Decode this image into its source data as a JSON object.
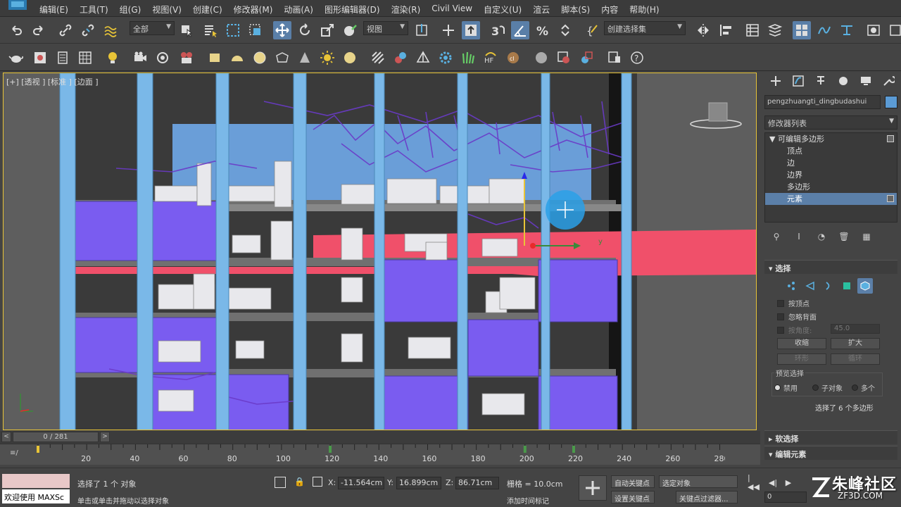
{
  "menu": [
    "编辑(E)",
    "工具(T)",
    "组(G)",
    "视图(V)",
    "创建(C)",
    "修改器(M)",
    "动画(A)",
    "图形编辑器(D)",
    "渲染(R)",
    "Civil View",
    "自定义(U)",
    "渲云",
    "脚本(S)",
    "内容",
    "帮助(H)"
  ],
  "toolbar": {
    "selection_filter": "全部",
    "ref_coord": "视图",
    "named_selection": "创建选择集"
  },
  "viewport": {
    "label": "[+] [透视 ] [标准 ] [边面 ]",
    "axis_label": "y"
  },
  "command_panel": {
    "object_name": "pengzhuangti_dingbudashui",
    "object_color": "#5b9bd5",
    "modifier_list": "修改器列表",
    "stack": [
      {
        "label": "可编辑多边形",
        "root": true
      },
      {
        "label": "顶点"
      },
      {
        "label": "边"
      },
      {
        "label": "边界"
      },
      {
        "label": "多边形"
      },
      {
        "label": "元素",
        "selected": true
      }
    ],
    "selection_title": "选择",
    "by_vertex": "按顶点",
    "ignore_backfacing": "忽略背面",
    "by_angle": "按角度:",
    "angle_value": "45.0",
    "shrink": "收缩",
    "grow": "扩大",
    "ring": "环形",
    "loop": "循环",
    "preview_selection": "预览选择",
    "preview_options": [
      "禁用",
      "子对象",
      "多个"
    ],
    "status": "选择了 6 个多边形",
    "soft_selection": "软选择",
    "edit_elements": "编辑元素"
  },
  "timeline": {
    "frame_display": "0 / 281",
    "ticks": [
      "20",
      "40",
      "60",
      "80",
      "100",
      "120",
      "140",
      "160",
      "180",
      "200",
      "220",
      "240",
      "260",
      "280"
    ]
  },
  "status": {
    "maxscript_welcome": "欢迎使用 MAXSc",
    "selected": "选择了 1 个 对象",
    "prompt": "单击或单击并拖动以选择对象",
    "x_label": "X:",
    "x": "-11.564cm",
    "y_label": "Y:",
    "y": "16.899cm",
    "z_label": "Z:",
    "z": "86.71cm",
    "grid": "栅格 = 10.0cm",
    "add_time_tag": "添加时间标记",
    "auto_key": "自动关键点",
    "set_key": "设置关键点",
    "selected_object": "选定对象",
    "key_filters": "关键点过滤器...",
    "frame": "0"
  },
  "watermark": {
    "text": "朱峰社区",
    "url": "ZF3D.COM"
  }
}
